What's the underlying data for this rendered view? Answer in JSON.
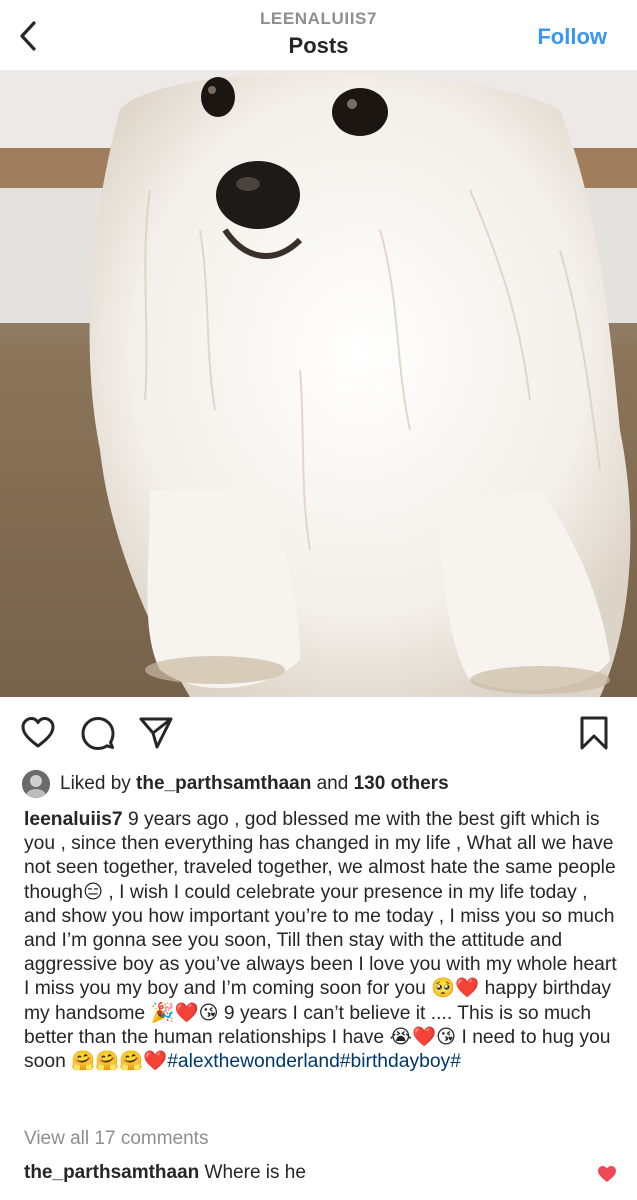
{
  "header": {
    "username": "LEENALUIIS7",
    "title": "Posts",
    "follow_label": "Follow",
    "back_icon": "chevron-left-icon"
  },
  "post": {
    "image_subject": "white fluffy dog",
    "actions": {
      "like_icon": "heart-outline-icon",
      "comment_icon": "comment-bubble-icon",
      "share_icon": "paper-plane-icon",
      "save_icon": "bookmark-icon"
    },
    "likes": {
      "prefix": "Liked by ",
      "user": "the_parthsamthaan",
      "middle": " and ",
      "others": "130 others"
    },
    "caption": {
      "username": "leenaluiis7",
      "text": " 9 years ago , god blessed me with the best gift which is you , since then everything has changed in my life , What all we have not seen together, traveled together, we almost hate the same people though😑 , I wish I could celebrate your presence in my life today , and show you how important you’re to me today , I miss you so much and I’m gonna see you soon, Till then stay with the attitude and aggressive boy as you’ve always been I love you with my whole heart I miss you my boy and I’m coming soon for you 🥺❤️ happy birthday my handsome 🎉❤️😘 9 years I can’t believe it .... This is so much better than the human relationships I have 😭❤️😘 I need to hug you soon 🤗🤗🤗❤️",
      "hashtags": "#alexthewonderland#birthdayboy#"
    },
    "view_comments": "View all 17 comments",
    "comment": {
      "username": "the_parthsamthaan",
      "text": " Where is he"
    }
  },
  "colors": {
    "link_blue": "#3897f0",
    "hashtag": "#00376b",
    "muted": "#8e8e8e",
    "heart_red": "#ed4956"
  }
}
